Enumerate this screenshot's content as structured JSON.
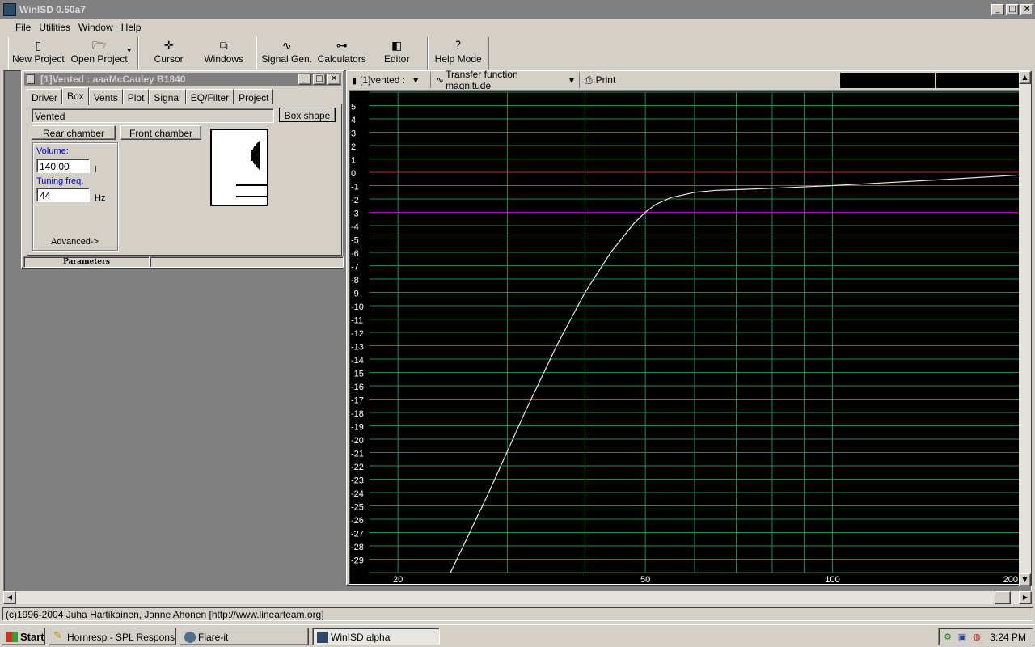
{
  "window": {
    "title": "WinISD 0.50a7"
  },
  "menu": [
    {
      "label": "File",
      "u": "F",
      "rest": "ile"
    },
    {
      "label": "Utilities",
      "u": "U",
      "rest": "tilities"
    },
    {
      "label": "Window",
      "u": "W",
      "rest": "indow"
    },
    {
      "label": "Help",
      "u": "H",
      "rest": "elp"
    }
  ],
  "toolbar": {
    "new_project": "New Project",
    "open_project": "Open Project",
    "cursor": "Cursor",
    "windows": "Windows",
    "signal_gen": "Signal Gen.",
    "calculators": "Calculators",
    "editor": "Editor",
    "help_mode": "Help Mode"
  },
  "params": {
    "title": "[1]Vented : aaaMcCauley B1840",
    "tabs": [
      "Driver",
      "Box",
      "Vents",
      "Plot",
      "Signal",
      "EQ/Filter",
      "Project"
    ],
    "active_tab": "Box",
    "box_type": "Vented",
    "box_shape_button": "Box shape",
    "rear_chamber": "Rear chamber",
    "front_chamber": "Front chamber",
    "volume_label": "Volume:",
    "volume_value": "140.00",
    "volume_unit": "l",
    "tuning_label": "Tuning freq.",
    "tuning_value": "44",
    "tuning_unit": "Hz",
    "advanced": "Advanced->",
    "status_tab": "Parameters"
  },
  "graph": {
    "project_select": "[1]vented :",
    "plot_type": "Transfer function magnitude",
    "print": "Print"
  },
  "chart_data": {
    "type": "line",
    "xscale": "log",
    "xlim": [
      18,
      200
    ],
    "ylim": [
      -30,
      6
    ],
    "x_ticks": [
      "20",
      "50",
      "100",
      "200"
    ],
    "y_ticks": [
      "5",
      "4",
      "3",
      "2",
      "1",
      "0",
      "-1",
      "-2",
      "-3",
      "-4",
      "-5",
      "-6",
      "-7",
      "-8",
      "-9",
      "-10",
      "-11",
      "-12",
      "-13",
      "-14",
      "-15",
      "-16",
      "-17",
      "-18",
      "-19",
      "-20",
      "-21",
      "-22",
      "-23",
      "-24",
      "-25",
      "-26",
      "-27",
      "-28",
      "-29"
    ],
    "reference_lines": [
      {
        "y": 0,
        "color": "#d02020"
      },
      {
        "y": -3,
        "color": "#b000b0"
      }
    ],
    "grid": true,
    "series": [
      {
        "color": "#e8e8e8",
        "x": [
          24.3,
          28,
          32,
          36,
          40,
          44,
          48,
          50,
          52,
          55,
          60,
          65,
          70,
          80,
          100,
          120,
          150,
          200
        ],
        "y": [
          -30,
          -24,
          -18,
          -13,
          -9,
          -6,
          -3.8,
          -3.0,
          -2.4,
          -1.9,
          -1.5,
          -1.35,
          -1.3,
          -1.2,
          -1.0,
          -0.8,
          -0.55,
          -0.2
        ]
      }
    ]
  },
  "statusbar": {
    "text": "(c)1996-2004 Juha Hartikainen, Janne Ahonen [http://www.linearteam.org]"
  },
  "taskbar": {
    "start": "Start",
    "tasks": [
      "Hornresp - SPL Response",
      "Flare-it",
      "WinISD alpha"
    ],
    "clock": "3:24 PM"
  }
}
